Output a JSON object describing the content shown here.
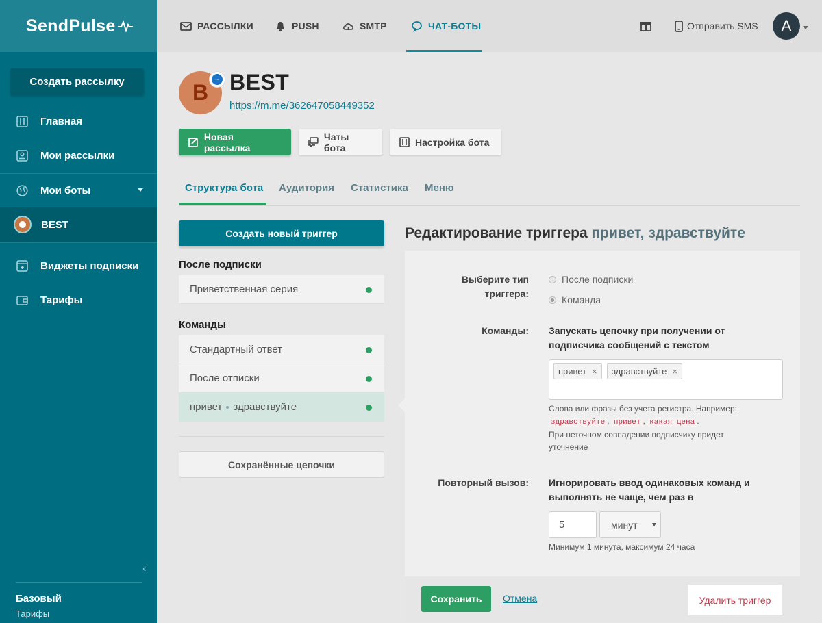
{
  "brand": {
    "name": "SendPulse"
  },
  "sidebar": {
    "create_button": "Создать рассылку",
    "items": [
      {
        "label": "Главная",
        "icon": "dashboard-icon"
      },
      {
        "label": "Мои рассылки",
        "icon": "campaigns-icon"
      },
      {
        "label": "Мои боты",
        "icon": "globe-icon"
      },
      {
        "label": "BEST",
        "icon": "bot-avatar"
      },
      {
        "label": "Виджеты подписки",
        "icon": "widget-icon"
      },
      {
        "label": "Тарифы",
        "icon": "wallet-icon"
      }
    ],
    "plan": {
      "name": "Базовый",
      "link": "Тарифы"
    }
  },
  "topnav": {
    "items": [
      {
        "label": "РАССЫЛКИ",
        "icon": "envelope-icon"
      },
      {
        "label": "PUSH",
        "icon": "bell-icon"
      },
      {
        "label": "SMTP",
        "icon": "cloud-icon"
      },
      {
        "label": "ЧАТ-БОТЫ",
        "icon": "chat-icon",
        "active": true
      }
    ],
    "sms": "Отправить SMS",
    "avatar_letter": "A"
  },
  "bot": {
    "avatar_letter": "B",
    "name": "BEST",
    "url": "https://m.me/362647058449352"
  },
  "actions": {
    "new_campaign": "Новая рассылка",
    "bot_chats": "Чаты бота",
    "bot_settings": "Настройка бота"
  },
  "tabs": [
    "Структура бота",
    "Аудитория",
    "Статистика",
    "Меню"
  ],
  "triggers": {
    "create_button": "Создать новый триггер",
    "after_subscribe_title": "После подписки",
    "after_subscribe": [
      "Приветственная серия"
    ],
    "commands_title": "Команды",
    "commands": [
      "Стандартный ответ",
      "После отписки"
    ],
    "selected": {
      "part1": "привет",
      "part2": "здравствуйте"
    },
    "saved_chains": "Сохранённые цепочки"
  },
  "edit": {
    "title_prefix": "Редактирование триггера",
    "title_name": "привет, здравствуйте",
    "type_label_1": "Выберите тип",
    "type_label_2": "триггера:",
    "type_option_1": "После подписки",
    "type_option_2": "Команда",
    "commands_label": "Команды:",
    "commands_desc_1": "Запускать цепочку при получении от",
    "commands_desc_2": "подписчика сообщений с текстом",
    "tags": [
      "привет",
      "здравствуйте"
    ],
    "tag_remove": "×",
    "hint_1": "Слова или фразы без учета регистра. Например:",
    "examples": [
      "здравствуйте",
      "привет",
      "какая цена"
    ],
    "hint_2": "При неточном совпадении подписчику придет",
    "hint_3": "уточнение",
    "repeat_label": "Повторный вызов:",
    "repeat_desc_1": "Игнорировать ввод одинаковых команд и",
    "repeat_desc_2": "выполнять не чаще, чем раз в",
    "repeat_value": "5",
    "repeat_unit": "минут",
    "repeat_hint": "Минимум 1 минута, максимум 24 часа",
    "save": "Сохранить",
    "cancel": "Отмена",
    "delete": "Удалить триггер"
  },
  "colors": {
    "sidebar": "#006e80",
    "accent": "#0f7d92",
    "green": "#2d9e64",
    "danger": "#c0394d"
  }
}
